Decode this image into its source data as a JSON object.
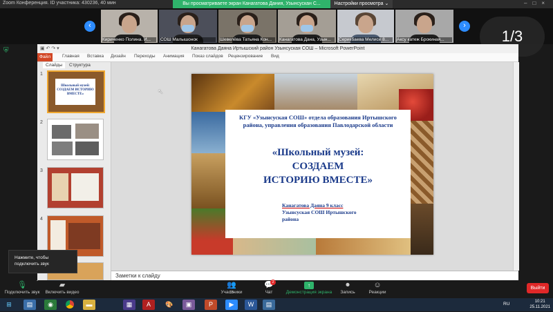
{
  "zoom": {
    "window_title": "Zoom Конференция. ID участника: 430236, 40 мин",
    "share_banner": "Вы просматриваете экран Канагатова Дания, Узынсускан С...",
    "view_options": "Настройки просмотра ⌄",
    "page_indicator": "1/3",
    "participants": [
      {
        "name": "Кириченко Полина. И..."
      },
      {
        "name": "СОШ Малышонок"
      },
      {
        "name": "Шевелёва Татьяна Кон..."
      },
      {
        "name": "Канагатова Дана, Узын..."
      },
      {
        "name": "Серикбаева Мелисе 8..."
      },
      {
        "name": "Аксу катеж Брокиная..."
      }
    ],
    "popup": {
      "line1": "Нажмите, чтобы",
      "line2": "подключить звук"
    },
    "toolbar": {
      "unmute": "Подключить звук",
      "start_video": "Включить видео",
      "participants": "Участники",
      "participants_count": "18",
      "chat": "Чат",
      "chat_badge": "2",
      "share_screen": "Демонстрация экрана",
      "record": "Запись",
      "reactions": "Реакции",
      "leave": "Выйти"
    }
  },
  "powerpoint": {
    "title": "Канагатова Даяна Иртышский район Узынсуская СОШ  –  Microsoft PowerPoint",
    "file_tab": "Файл",
    "ribbon_tabs": [
      "Главная",
      "Вставка",
      "Дизайн",
      "Переходы",
      "Анимация",
      "Показ слайдов",
      "Рецензирование",
      "Вид"
    ],
    "pane_tabs": {
      "slides": "Слайды",
      "outline": "Структура"
    },
    "slide_numbers": [
      "1",
      "2",
      "3",
      "4",
      "5"
    ],
    "notes_placeholder": "Заметки к слайду",
    "slide": {
      "org_text": "КГУ «Узынсуская СОШ» отдела образования Иртышского района, управления образования Павлодарской области",
      "title_line1": "«Школьный музей:",
      "title_line2": "СОЗДАЕМ",
      "title_line3": "ИСТОРИЮ ВМЕСТЕ»",
      "author_line1": "Канагатова  Даяна 9 класс",
      "author_line2": "Узынсуская СОШ Иртышского",
      "author_line3": "района",
      "thumb_title": "Школьный музей: СОЗДАЕМ ИСТОРИЮ ВМЕСТЕ»"
    }
  },
  "taskbar": {
    "language": "RU",
    "time": "10:21",
    "date": "25.11.2021"
  },
  "colors": {
    "zoom_green": "#2fb36b",
    "zoom_blue": "#2d8cff",
    "leave_red": "#e02828",
    "ppt_orange": "#d24726",
    "slide_text_blue": "#1a3a8a"
  }
}
